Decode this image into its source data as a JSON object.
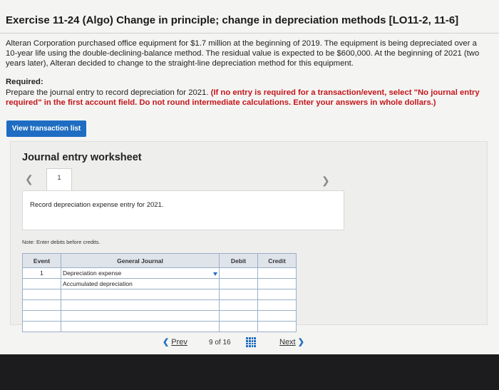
{
  "title": "Exercise 11-24 (Algo) Change in principle; change in depreciation methods [LO11-2, 11-6]",
  "problem": "Alteran Corporation purchased office equipment for $1.7 million at the beginning of 2019. The equipment is being depreciated over a 10-year life using the double-declining-balance method. The residual value is expected to be $600,000. At the beginning of 2021 (two years later), Alteran decided to change to the straight-line depreciation method for this equipment.",
  "required": {
    "heading": "Required:",
    "text": "Prepare the journal entry to record depreciation for 2021. ",
    "instruction": "(If no entry is required for a transaction/event, select \"No journal entry required\" in the first account field. Do not round intermediate calculations. Enter your answers in whole dollars.)"
  },
  "view_button": "View transaction list",
  "worksheet": {
    "title": "Journal entry worksheet",
    "tab": "1",
    "description": "Record depreciation expense entry for 2021.",
    "note": "Note: Enter debits before credits.",
    "headers": {
      "event": "Event",
      "general_journal": "General Journal",
      "debit": "Debit",
      "credit": "Credit"
    },
    "rows": [
      {
        "event": "1",
        "account": "Depreciation expense",
        "debit": "",
        "credit": ""
      },
      {
        "event": "",
        "account": "Accumulated depreciation",
        "debit": "",
        "credit": ""
      },
      {
        "event": "",
        "account": "",
        "debit": "",
        "credit": ""
      },
      {
        "event": "",
        "account": "",
        "debit": "",
        "credit": ""
      },
      {
        "event": "",
        "account": "",
        "debit": "",
        "credit": ""
      },
      {
        "event": "",
        "account": "",
        "debit": "",
        "credit": ""
      }
    ]
  },
  "pager": {
    "prev": "Prev",
    "count": "9 of 16",
    "next": "Next"
  },
  "colors": {
    "accent": "#1e6dc2",
    "required": "#c4161c"
  }
}
